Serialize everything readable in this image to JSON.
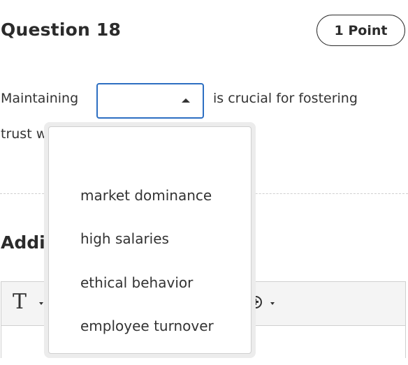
{
  "question": {
    "title": "Question 18",
    "points": "1 Point",
    "sentence_before": "Maintaining",
    "sentence_after": "is crucial for fostering",
    "sentence_second_line_visible": "trust w"
  },
  "blank": {
    "selected_value": "",
    "expanded": true,
    "options": [
      "",
      "market dominance",
      "high salaries",
      "ethical behavior",
      "employee turnover"
    ]
  },
  "additional_section": {
    "title_visible": "Addit"
  },
  "editor": {
    "tools": [
      "text-format-icon",
      "insert-plus-icon"
    ]
  },
  "colors": {
    "focus_border": "#2d6fc2",
    "text": "#333333",
    "toolbar_bg": "#f4f4f4"
  }
}
